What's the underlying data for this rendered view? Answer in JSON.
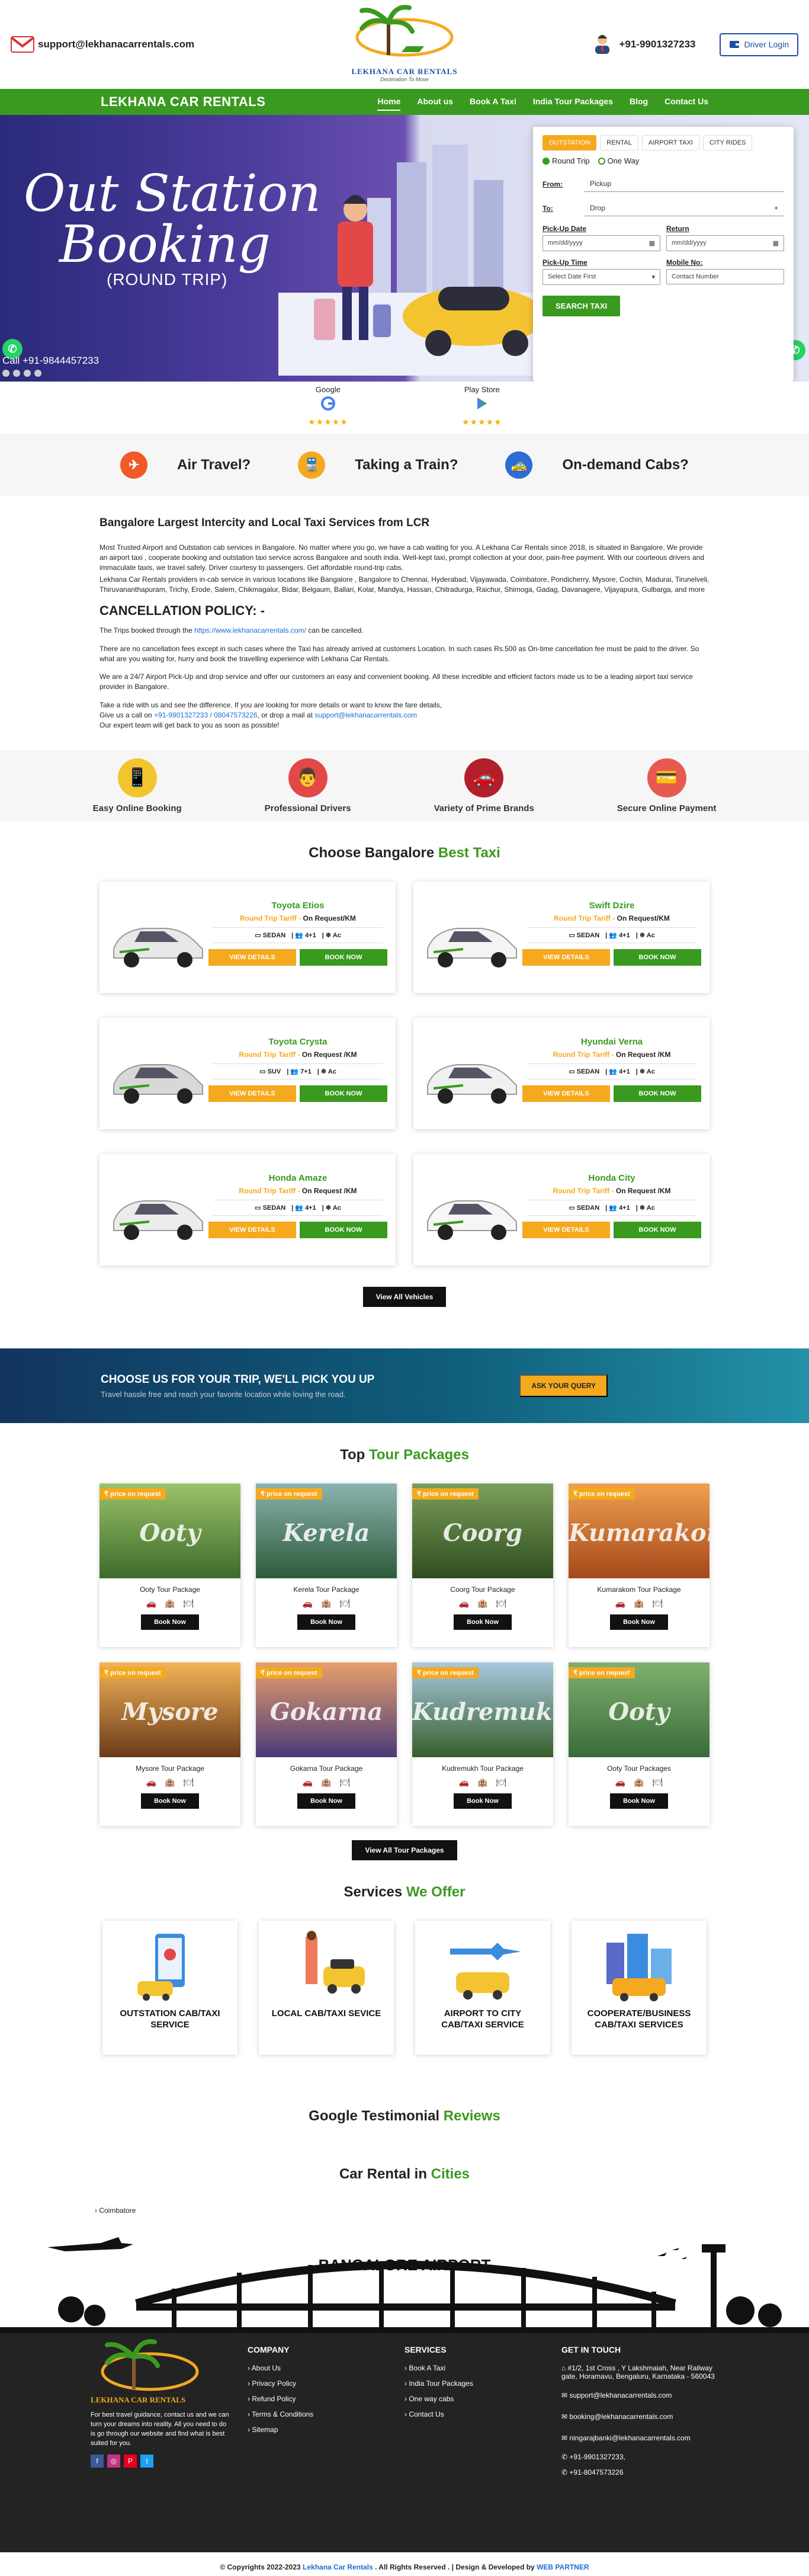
{
  "topbar": {
    "email": "support@lekhanacarrentals.com",
    "logo_name": "LEKHANA CAR RENTALS",
    "logo_tagline": "Destination To Move",
    "phone": "+91-9901327233",
    "driver_login": "Driver Login"
  },
  "nav": {
    "brand": "LEKHANA CAR RENTALS",
    "items": [
      "Home",
      "About us",
      "Book A Taxi",
      "India Tour Packages",
      "Blog",
      "Contact Us"
    ]
  },
  "hero": {
    "line1": "Out Station",
    "line2": "Booking",
    "line3": "(ROUND TRIP)",
    "call": "Call +91-9844457233"
  },
  "booking": {
    "tabs": [
      "OUTSTATION",
      "RENTAL",
      "AIRPORT TAXI",
      "CITY RIDES"
    ],
    "radio1": "Round Trip",
    "radio2": "One Way",
    "from_label": "From:",
    "from_value": "Pickup",
    "to_label": "To:",
    "to_value": "Drop",
    "pickup_date_label": "Pick-Up Date",
    "return_label": "Return",
    "date_placeholder": "mm/dd/yyyy",
    "pickup_time_label": "Pick-Up Time",
    "mobile_label": "Mobile No:",
    "time_value": "Select Date First",
    "mobile_placeholder": "Contact Number",
    "search_btn": "SEARCH TAXI"
  },
  "stores": {
    "google": "Google",
    "playstore": "Play Store",
    "stars": "★★★★★"
  },
  "travel": [
    "Air Travel?",
    "Taking a Train?",
    "On-demand Cabs?"
  ],
  "intro": {
    "heading": "Bangalore Largest Intercity and Local Taxi Services from LCR",
    "p1": "Most Trusted Airport and Outstation cab services in Bangalore. No matter where you go, we have a cab waiting for you. A Lekhana Car Rentals since 2018, is situated in Bangalore. We provide an airport taxi , cooperate booking and outstation taxi service across Bangalore and south india. Well-kept taxi, prompt collection at your door, pain-free payment. With our courteous drivers and immaculate taxis, we travel safely. Driver courtesy to passengers. Get affordable round-trip cabs.",
    "p2": "Lekhana Car Rentals providers in-cab service in various locations like Bangalore , Bangalore to Chennai, Hyderabad, Vijayawada, Coimbatore, Pondicherry, Mysore, Cochin, Madurai, Tirunelveli, Thiruvananthapuram, Trichy, Erode, Salem, Chikmagalur, Bidar, Belgaum, Ballari, Kolar, Mandya, Hassan, Chitradurga, Raichur, Shimoga, Gadag, Davanagere, Vijayapura, Gulbarga, and more",
    "cancel_heading": "CANCELLATION POLICY: -",
    "p3_pre": "The Trips booked through the ",
    "p3_link": "https://www.lekhanacarrentals.com/",
    "p3_post": " can be cancelled.",
    "p4": "There are no cancellation fees except in such cases where the Taxi has already arrived at customers Location. In such cases Rs.500 as On-time cancellation fee must be paid to the driver. So what are you waiting for, hurry and book the travelling experience with Lekhana Car Rentals.",
    "p5": "We are a 24/7 Airport Pick-Up and drop service and offer our customers an easy and convenient booking. All these incredible and efficient factors made us to be a leading airport taxi service provider in Bangalore.",
    "p6a": "Take a ride with us and see the difference. If you are looking for more details or want to know the fare details,",
    "p6b_pre": "Give us a call on ",
    "p6b_phones": "+91-9901327233 / 08047573226",
    "p6b_mid": ", or drop a mail at ",
    "p6b_mail": "support@lekhanacarrentals.com",
    "p6c": "Our expert team will get back to you as soon as possible!"
  },
  "features": [
    "Easy Online Booking",
    "Professional Drivers",
    "Variety of Prime Brands",
    "Secure Online Payment"
  ],
  "cars_title_a": "Choose Bangalore",
  "cars_title_b": "Best Taxi",
  "cars": [
    {
      "name": "Toyota Etios",
      "tariff": "On Request/KM",
      "type": "SEDAN",
      "seats": "4+1",
      "ac": "Ac"
    },
    {
      "name": "Swift Dzire",
      "tariff": "On Request/KM",
      "type": "SEDAN",
      "seats": "4+1",
      "ac": "Ac"
    },
    {
      "name": "Toyota Crysta",
      "tariff": "On Request /KM",
      "type": "SUV",
      "seats": "7+1",
      "ac": "Ac"
    },
    {
      "name": "Hyundai Verna",
      "tariff": "On Request /KM",
      "type": "SEDAN",
      "seats": "4+1",
      "ac": "Ac"
    },
    {
      "name": "Honda Amaze",
      "tariff": "On Request /KM",
      "type": "SEDAN",
      "seats": "4+1",
      "ac": "Ac"
    },
    {
      "name": "Honda City",
      "tariff": "On Request /KM",
      "type": "SEDAN",
      "seats": "4+1",
      "ac": "Ac"
    }
  ],
  "car_labels": {
    "tariff_prefix": "Round Trip Tariff - ",
    "details": "VIEW DETAILS",
    "book": "BOOK NOW",
    "view_all": "View All Vehicles"
  },
  "banner": {
    "title": "CHOOSE US FOR YOUR TRIP, WE'LL PICK YOU UP",
    "subtitle": "Travel hassle free and reach your favorite location while loving the road.",
    "button": "ASK YOUR QUERY"
  },
  "packages_title_a": "Top",
  "packages_title_b": "Tour Packages",
  "packages": [
    {
      "word": "Ooty",
      "name": "Ooty Tour Package",
      "c1": "#3d6b2a",
      "c2": "#9bc36a"
    },
    {
      "word": "Kerela",
      "name": "Kerela Tour Package",
      "c1": "#2d5a3a",
      "c2": "#8ab4b0"
    },
    {
      "word": "Coorg",
      "name": "Coorg Tour Package",
      "c1": "#2f4d1e",
      "c2": "#7ba05b"
    },
    {
      "word": "Kumarakom",
      "name": "Kumarakom Tour Package",
      "c1": "#a4481a",
      "c2": "#f0a050"
    },
    {
      "word": "Mysore",
      "name": "Mysore Tour Package",
      "c1": "#6b3a1a",
      "c2": "#f3b457"
    },
    {
      "word": "Gokarna",
      "name": "Gokarna Tour Package",
      "c1": "#4a3a7a",
      "c2": "#e8a06a"
    },
    {
      "word": "Kudremukh",
      "name": "Kudremukh Tour Package",
      "c1": "#375f2a",
      "c2": "#a8c8e0"
    },
    {
      "word": "Ooty",
      "name": "Ooty Tour Packages",
      "c1": "#3a6c3a",
      "c2": "#7fb06e"
    }
  ],
  "package_labels": {
    "tag": "₹ price on request",
    "book": "Book Now",
    "view_all": "View All Tour Packages"
  },
  "services_title_a": "Services",
  "services_title_b": "We Offer",
  "services": [
    "OUTSTATION CAB/TAXI SERVICE",
    "LOCAL CAB/TAXI SEVICE",
    "AIRPORT TO CITY CAB/TAXI SERVICE",
    "COOPERATE/BUSINESS CAB/TAXI SERVICES"
  ],
  "testimonial_a": "Google Testimonial",
  "testimonial_b": "Reviews",
  "cities_title_a": "Car Rental in",
  "cities_title_b": "Cities",
  "city": "Coimbatore",
  "airport": "BANGALORE AIRPORT",
  "footer": {
    "about": "For best travel guidance, contact us and we can turn your dreams into reality. All you need to do is go through our website and find what is best suited for you.",
    "company_h": "COMPANY",
    "company": [
      "About Us",
      "Privacy Policy",
      "Refund Policy",
      "Terms & Conditions",
      "Sitemap"
    ],
    "services_h": "SERVICES",
    "services": [
      "Book A Taxi",
      "India Tour Packages",
      "One way cabs",
      "Contact Us"
    ],
    "touch_h": "GET IN TOUCH",
    "address": "#1/2, 1st Cross , Y Lakshmaiah, Near Railway gate, Horamavu, Bengaluru, Karnataka - 560043",
    "mail1": "support@lekhanacarrentals.com",
    "mail2": "booking@lekhanacarrentals.com",
    "mail3": "ningarajbanki@lekhanacarrentals.com",
    "phone1": "+91-9901327233,",
    "phone2": "+91-8047573226"
  },
  "copyright": {
    "pre": "© Copyrights 2022-2023 ",
    "brand": "Lekhana Car Rentals",
    "mid": " . All Rights Reserved . | Design & Developed by ",
    "dev": "WEB PARTNER"
  }
}
